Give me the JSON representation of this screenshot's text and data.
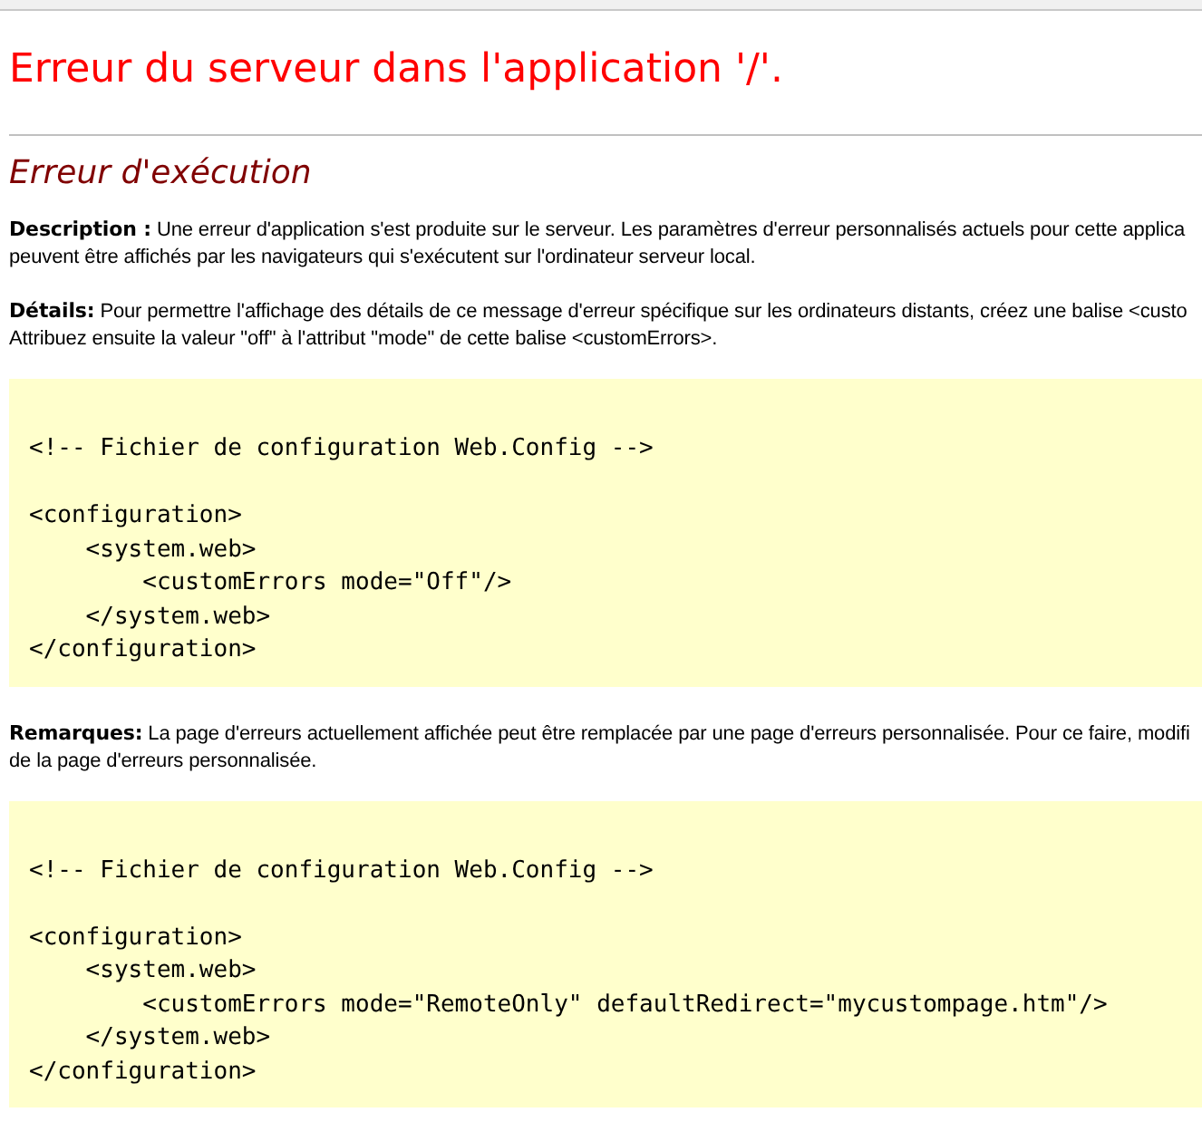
{
  "title": "Erreur du serveur dans l'application '/'.",
  "subtitle": "Erreur d'exécution",
  "sections": [
    {
      "kind": "text",
      "lines": [
        "**Description :** Une erreur d'application s'est produite sur le serveur. Les paramètres d'erreur personnalisés actuels pour cette applica",
        "peuvent être affichés par les navigateurs qui s'exécutent sur l'ordinateur serveur local."
      ]
    },
    {
      "kind": "text",
      "lines": [
        "**Détails:** Pour permettre l'affichage des détails de ce message d'erreur spécifique sur les ordinateurs distants, créez une balise <custo",
        "Attribuez ensuite la valeur \"off\" à l'attribut \"mode\" de cette balise <customErrors>."
      ]
    },
    {
      "kind": "code",
      "code": "<!-- Fichier de configuration Web.Config -->\n\n<configuration>\n    <system.web>\n        <customErrors mode=\"Off\"/>\n    </system.web>\n</configuration>"
    },
    {
      "kind": "text",
      "lines": [
        "**Remarques:** La page d'erreurs actuellement affichée peut être remplacée par une page d'erreurs personnalisée. Pour ce faire, modifi",
        "de la page d'erreurs personnalisée."
      ]
    },
    {
      "kind": "code",
      "code": "<!-- Fichier de configuration Web.Config -->\n\n<configuration>\n    <system.web>\n        <customErrors mode=\"RemoteOnly\" defaultRedirect=\"mycustompage.htm\"/>\n    </system.web>\n</configuration>"
    }
  ]
}
